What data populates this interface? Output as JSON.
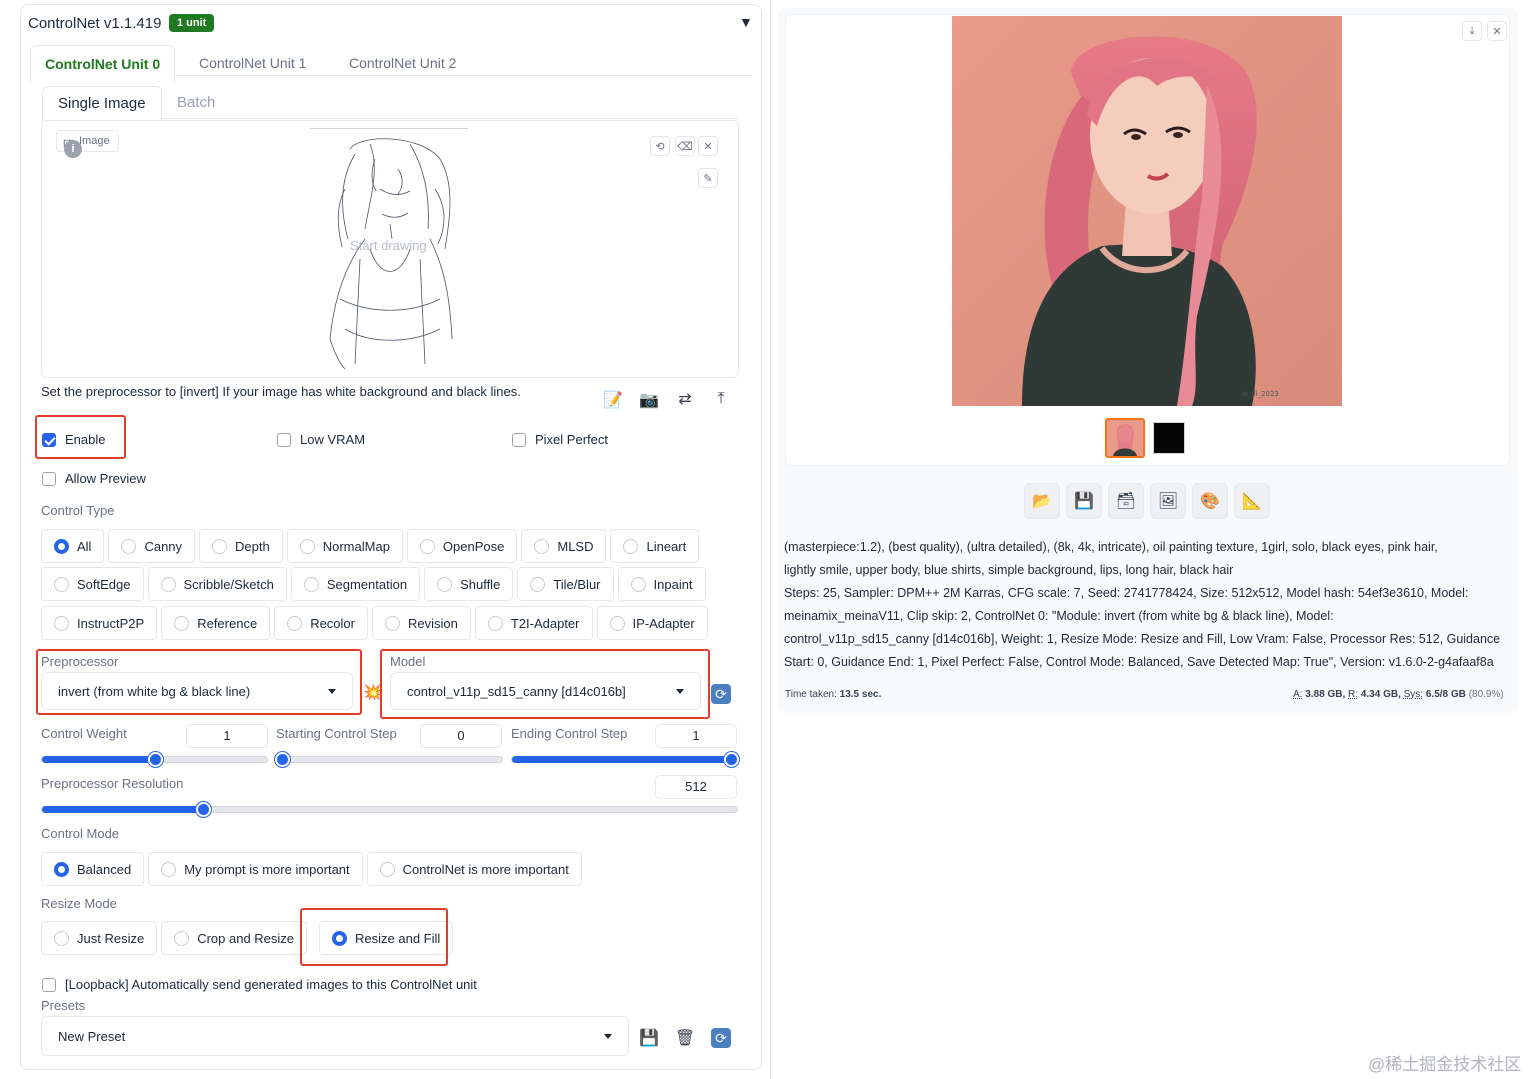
{
  "controlnet": {
    "title": "ControlNet v1.1.419",
    "badge": "1 unit",
    "units": [
      "ControlNet Unit 0",
      "ControlNet Unit 1",
      "ControlNet Unit 2"
    ],
    "image_tabs": [
      "Single Image",
      "Batch"
    ],
    "image_label": "Image",
    "canvas_hint": "Start drawing",
    "hint_text": "Set the preprocessor to [invert] If your image has white background and black lines.",
    "checkboxes": {
      "enable": "Enable",
      "low_vram": "Low VRAM",
      "pixel_perfect": "Pixel Perfect",
      "allow_preview": "Allow Preview"
    },
    "control_type_label": "Control Type",
    "control_types_row1": [
      "All",
      "Canny",
      "Depth",
      "NormalMap",
      "OpenPose",
      "MLSD",
      "Lineart"
    ],
    "control_types_row2": [
      "SoftEdge",
      "Scribble/Sketch",
      "Segmentation",
      "Shuffle",
      "Tile/Blur",
      "Inpaint"
    ],
    "control_types_row3": [
      "InstructP2P",
      "Reference",
      "Recolor",
      "Revision",
      "T2I-Adapter",
      "IP-Adapter"
    ],
    "control_type_selected": "All",
    "preprocessor_label": "Preprocessor",
    "preprocessor_value": "invert (from white bg & black line)",
    "model_label": "Model",
    "model_value": "control_v11p_sd15_canny [d14c016b]",
    "control_weight_label": "Control Weight",
    "control_weight": "1",
    "starting_step_label": "Starting Control Step",
    "starting_step": "0",
    "ending_step_label": "Ending Control Step",
    "ending_step": "1",
    "preproc_res_label": "Preprocessor Resolution",
    "preproc_res": "512",
    "sliders": {
      "control_weight_fraction": 0.5,
      "starting_step_fraction": 0.0,
      "ending_step_fraction": 1.0,
      "preproc_res_fraction": 0.232
    },
    "control_mode_label": "Control Mode",
    "control_modes": [
      "Balanced",
      "My prompt is more important",
      "ControlNet is more important"
    ],
    "control_mode_selected": "Balanced",
    "resize_mode_label": "Resize Mode",
    "resize_modes": [
      "Just Resize",
      "Crop and Resize",
      "Resize and Fill"
    ],
    "resize_mode_selected": "Resize and Fill",
    "loopback_label": "[Loopback] Automatically send generated images to this ControlNet unit",
    "presets_label": "Presets",
    "preset_value": "New Preset"
  },
  "output": {
    "info_lines": [
      "(masterpiece:1.2), (best quality), (ultra detailed), (8k, 4k, intricate), oil painting texture, 1girl, solo, black eyes, pink hair,",
      "lightly smile, upper body, blue shirts, simple background, lips, long hair, black hair",
      "Steps: 25, Sampler: DPM++ 2M Karras, CFG scale: 7, Seed: 2741778424, Size: 512x512, Model hash: 54ef3e3610, Model:",
      "meinamix_meinaV11, Clip skip: 2, ControlNet 0: \"Module: invert (from white bg & black line), Model:",
      "control_v11p_sd15_canny [d14c016b], Weight: 1, Resize Mode: Resize and Fill, Low Vram: False, Processor Res: 512, Guidance",
      "Start: 0, Guidance End: 1, Pixel Perfect: False, Control Mode: Balanced, Save Detected Map: True\", Version: v1.6.0-2-g4afaaf8a"
    ],
    "time_label": "Time taken:",
    "time_value": "13.5 sec.",
    "vram_a_label": "A:",
    "vram_a": "3.88 GB,",
    "vram_r_label": "R:",
    "vram_r": "4.34 GB,",
    "vram_sys_label": "Sys:",
    "vram_sys": "6.5/8 GB",
    "vram_pct": "(80.9%)",
    "watermark": "@稀土掘金技术社区",
    "image_signature": "ai_lll_2023"
  },
  "colors": {
    "accent": "#2563eb",
    "highlight": "#e03e2d",
    "badge": "#1f7a1f",
    "portrait_bg": "#e8988a"
  }
}
